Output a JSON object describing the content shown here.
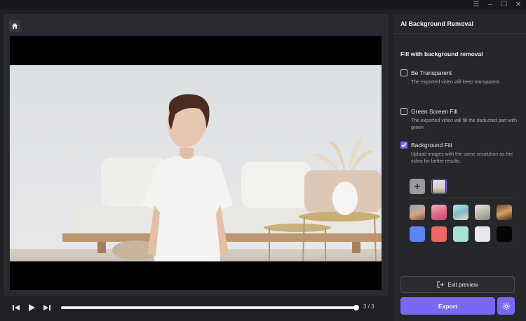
{
  "window": {
    "menu_icon": "hamburger-icon",
    "minimize_icon": "minimize-icon",
    "maximize_icon": "maximize-icon",
    "close_icon": "close-icon"
  },
  "preview": {
    "home_icon": "home-icon",
    "counter": "3 / 3",
    "progress": 0.99
  },
  "panel": {
    "title": "AI Background Removal",
    "section_title": "Fill with background removal",
    "options": [
      {
        "label": "Be Transparent",
        "description": "The exported video will keep transparent.",
        "checked": false
      },
      {
        "label": "Green Screen Fill",
        "description": "The exported video will fill the deducted part with green.",
        "checked": false
      },
      {
        "label": "Background Fill",
        "description": "Upload images with the same resolution as the video for better results.",
        "checked": true
      }
    ],
    "add_image_icon": "plus-icon",
    "image_presets": [
      "preset-image-1",
      "preset-image-2",
      "preset-image-3",
      "preset-image-4",
      "preset-image-5"
    ],
    "color_presets": [
      "#5b86f7",
      "#f26565",
      "#a6e3d6",
      "#e7e7e9",
      "#050505"
    ],
    "exit_preview_label": "Exit preview",
    "export_label": "Export"
  },
  "colors": {
    "accent": "#7a68f5",
    "panel_bg": "#26272b",
    "app_bg": "#1f2024"
  }
}
